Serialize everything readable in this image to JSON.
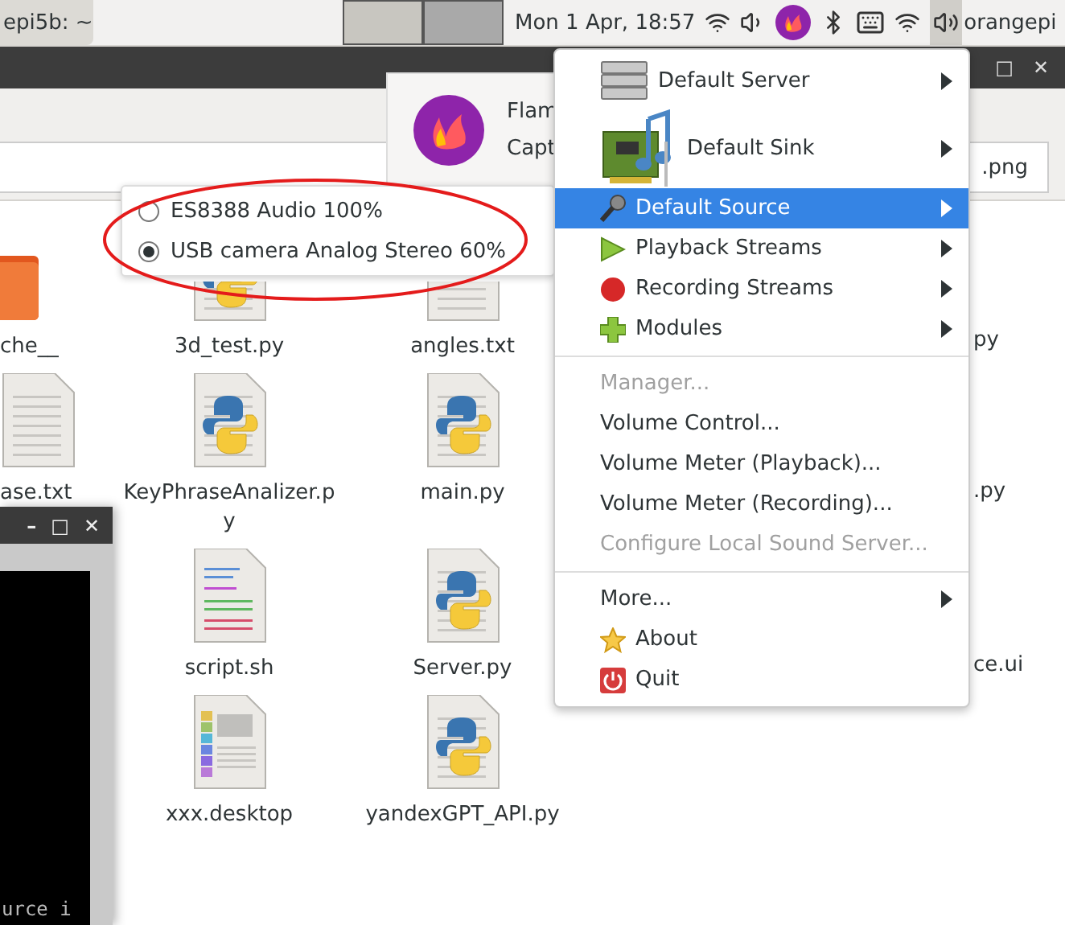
{
  "panel": {
    "task_button": "epi5b: ~",
    "clock": "Mon  1 Apr, 18:57",
    "user": "orangepi"
  },
  "file_manager": {
    "window_buttons": [
      "□",
      "✕"
    ],
    "path_tail": ".png",
    "edge_files": [
      {
        "name": "che__",
        "kind": "folder"
      },
      {
        "name": "ase.txt",
        "kind": "text"
      }
    ],
    "files": [
      {
        "name": "3d_test.py",
        "kind": "python"
      },
      {
        "name": "angles.txt",
        "kind": "text"
      },
      {
        "name": "KeyPhraseAnalizer.py",
        "kind": "python"
      },
      {
        "name": "main.py",
        "kind": "python"
      },
      {
        "name": "script.sh",
        "kind": "script"
      },
      {
        "name": "Server.py",
        "kind": "python"
      },
      {
        "name": "xxx.desktop",
        "kind": "desktop"
      },
      {
        "name": "yandexGPT_API.py",
        "kind": "python"
      }
    ],
    "right_column": [
      "py",
      ".py",
      "ce.ui"
    ]
  },
  "notification": {
    "title": "Flam",
    "body": "Capt"
  },
  "source_submenu": {
    "items": [
      {
        "label": "ES8388 Audio 100%",
        "selected": false
      },
      {
        "label": "USB camera Analog Stereo  60%",
        "selected": true
      }
    ]
  },
  "menu": {
    "sections": [
      {
        "items": [
          {
            "label": "Default Server",
            "kind": "server",
            "submenu": true,
            "selected": false,
            "disabled": false
          },
          {
            "label": "Default Sink",
            "kind": "sink",
            "submenu": true,
            "selected": false,
            "disabled": false
          },
          {
            "label": "Default Source",
            "kind": "source",
            "submenu": true,
            "selected": true,
            "disabled": false
          },
          {
            "label": "Playback Streams",
            "kind": "playback",
            "submenu": true,
            "selected": false,
            "disabled": false
          },
          {
            "label": "Recording Streams",
            "kind": "recording",
            "submenu": true,
            "selected": false,
            "disabled": false
          },
          {
            "label": "Modules",
            "kind": "modules",
            "submenu": true,
            "selected": false,
            "disabled": false
          }
        ]
      },
      {
        "items": [
          {
            "label": "Manager...",
            "kind": "action",
            "submenu": false,
            "selected": false,
            "disabled": true
          },
          {
            "label": "Volume Control...",
            "kind": "action",
            "submenu": false,
            "selected": false,
            "disabled": false
          },
          {
            "label": "Volume Meter (Playback)...",
            "kind": "action",
            "submenu": false,
            "selected": false,
            "disabled": false
          },
          {
            "label": "Volume Meter (Recording)...",
            "kind": "action",
            "submenu": false,
            "selected": false,
            "disabled": false
          },
          {
            "label": "Configure Local Sound Server...",
            "kind": "action",
            "submenu": false,
            "selected": false,
            "disabled": true
          }
        ]
      },
      {
        "items": [
          {
            "label": "More...",
            "kind": "action",
            "submenu": true,
            "selected": false,
            "disabled": false
          },
          {
            "label": "About",
            "kind": "about",
            "submenu": false,
            "selected": false,
            "disabled": false
          },
          {
            "label": "Quit",
            "kind": "quit",
            "submenu": false,
            "selected": false,
            "disabled": false
          }
        ]
      }
    ]
  },
  "terminal": {
    "window_buttons": [
      "–",
      "□",
      "✕"
    ],
    "text": "urce i"
  }
}
